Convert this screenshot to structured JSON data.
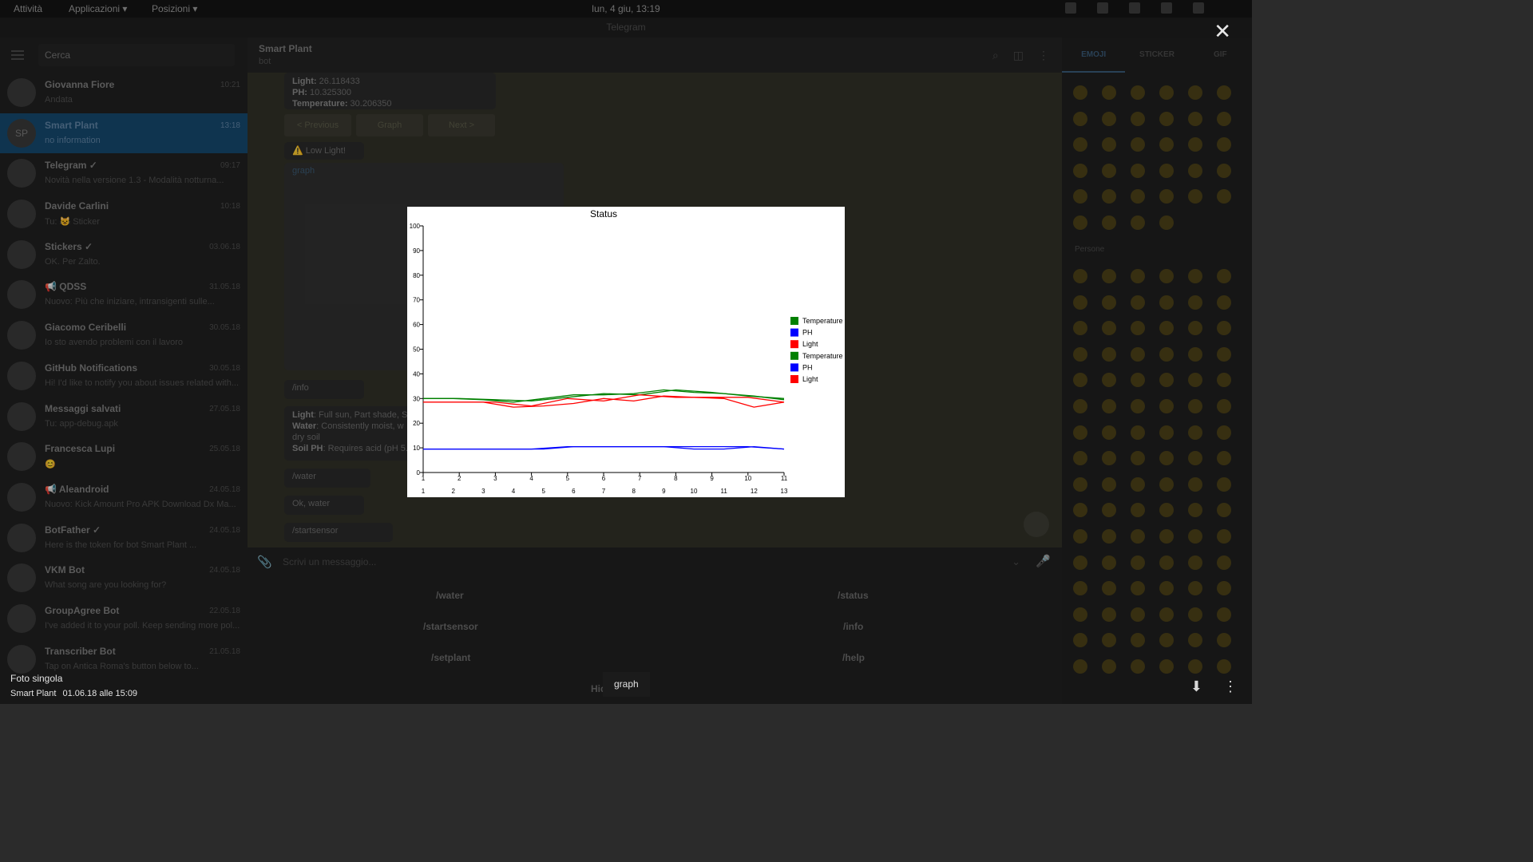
{
  "topbar": {
    "activities": "Attività",
    "applications": "Applicazioni ▾",
    "places": "Posizioni ▾",
    "clock": "lun, 4 giu, 13:19"
  },
  "window": {
    "title": "Telegram"
  },
  "sidebar": {
    "search_placeholder": "Cerca",
    "chats": [
      {
        "name": "Giovanna Fiore",
        "time": "10:21",
        "preview": "Andata",
        "initials": ""
      },
      {
        "name": "Smart Plant",
        "time": "13:18",
        "preview": "no information",
        "initials": "SP"
      },
      {
        "name": "Telegram ✓",
        "time": "09:17",
        "preview": "Novità nella versione 1.3 - Modalità notturna...",
        "initials": ""
      },
      {
        "name": "Davide Carlini",
        "time": "10:18",
        "preview": "Tu: 😺 Sticker",
        "initials": ""
      },
      {
        "name": "Stickers ✓",
        "time": "03.06.18",
        "preview": "OK. Per Zalto.",
        "initials": ""
      },
      {
        "name": "📢 QDSS",
        "time": "31.05.18",
        "preview": "Nuovo: Più che iniziare, intransigenti sulle...",
        "initials": ""
      },
      {
        "name": "Giacomo Ceribelli",
        "time": "30.05.18",
        "preview": "Io sto avendo problemi con il lavoro",
        "initials": ""
      },
      {
        "name": "GitHub Notifications",
        "time": "30.05.18",
        "preview": "Hi! I'd like to notify you about issues related with...",
        "initials": ""
      },
      {
        "name": "Messaggi salvati",
        "time": "27.05.18",
        "preview": "Tu: app-debug.apk",
        "initials": ""
      },
      {
        "name": "Francesca Lupi",
        "time": "25.05.18",
        "preview": "😊",
        "initials": ""
      },
      {
        "name": "📢 Aleandroid",
        "time": "24.05.18",
        "preview": "Nuovo: Kick Amount Pro APK Download Dx Ma...",
        "initials": ""
      },
      {
        "name": "BotFather ✓",
        "time": "24.05.18",
        "preview": "Here is the token for bot Smart Plant ...",
        "initials": ""
      },
      {
        "name": "VKM Bot",
        "time": "24.05.18",
        "preview": "What song are you looking for?",
        "initials": ""
      },
      {
        "name": "GroupAgree Bot",
        "time": "22.05.18",
        "preview": "I've added it to your poll. Keep sending more pol...",
        "initials": ""
      },
      {
        "name": "Transcriber Bot",
        "time": "21.05.18",
        "preview": "Tap on Antica Roma's button below to...",
        "initials": ""
      }
    ]
  },
  "chat": {
    "title": "Smart Plant",
    "subtitle": "bot",
    "status_lines": [
      {
        "label": "Light:",
        "value": " 26.118433"
      },
      {
        "label": "PH:",
        "value": " 10.325300"
      },
      {
        "label": "Temperature:",
        "value": " 30.206350"
      }
    ],
    "inline_buttons": [
      "< Previous",
      "Graph",
      "Next >"
    ],
    "low_light": "⚠️ Low Light!",
    "graph_label": "graph",
    "info_cmd": "/info",
    "info_lines": [
      {
        "label": "Light",
        "value": ": Full sun, Part shade, Sh"
      },
      {
        "label": "Water",
        "value": ": Consistently moist, w"
      },
      {
        "label": "",
        "value": "dry soil"
      },
      {
        "label": "Soil PH",
        "value": ": Requires acid (pH 5.5"
      }
    ],
    "water_cmd": "/water",
    "ok_water": "Ok, water",
    "startsensor_cmd": "/startsensor",
    "input_placeholder": "Scrivi un messaggio...",
    "commands": [
      "/water",
      "/status",
      "/startsensor",
      "/info",
      "/setplant",
      "/help"
    ],
    "hide_buttons": "Hide buttons"
  },
  "emoji_panel": {
    "tabs": [
      "EMOJI",
      "STICKER",
      "GIF"
    ],
    "section": "Persone"
  },
  "viewer": {
    "close": "✕",
    "caption": "graph",
    "footer_title": "Foto singola",
    "footer_sender": "Smart Plant",
    "footer_date": "01.06.18 alle 15:09",
    "tools": [
      "⬇",
      "⋮"
    ]
  },
  "chart_data": {
    "type": "line",
    "title": "Status",
    "ylim": [
      0,
      100
    ],
    "yticks": [
      0,
      10,
      20,
      30,
      40,
      50,
      60,
      70,
      80,
      90,
      100
    ],
    "x_axis_1": [
      1,
      2,
      3,
      4,
      5,
      6,
      7,
      8,
      9,
      10,
      11
    ],
    "x_axis_2": [
      1,
      2,
      3,
      4,
      5,
      6,
      7,
      8,
      9,
      10,
      11,
      12,
      13
    ],
    "legend": [
      "Temperature",
      "PH",
      "Light",
      "Temperature",
      "PH",
      "Light"
    ],
    "legend_placement": "right",
    "colors": {
      "Temperature": "#008000",
      "PH": "#0000ff",
      "Light": "#ff0000"
    },
    "series": [
      {
        "name": "Temperature",
        "axis": 1,
        "color": "#008000",
        "values": [
          30,
          30,
          29.5,
          29,
          30.5,
          32,
          31.5,
          33.5,
          32.5,
          31,
          30
        ]
      },
      {
        "name": "PH",
        "axis": 1,
        "color": "#0000ff",
        "values": [
          9.5,
          9.5,
          9.5,
          9.5,
          10.5,
          10.5,
          10.5,
          10.5,
          10.5,
          10.5,
          9.5
        ]
      },
      {
        "name": "Light",
        "axis": 1,
        "color": "#ff0000",
        "values": [
          28.5,
          28.5,
          28.5,
          27,
          30,
          29,
          31.5,
          30.5,
          30.5,
          30.5,
          28.5
        ]
      },
      {
        "name": "Temperature",
        "axis": 2,
        "color": "#008000",
        "values": [
          30,
          30,
          29.5,
          28.5,
          30,
          31.5,
          31.5,
          32,
          33.5,
          32.5,
          32,
          31,
          29.5
        ]
      },
      {
        "name": "PH",
        "axis": 2,
        "color": "#0000ff",
        "values": [
          9.5,
          9.5,
          9.5,
          9.5,
          9.5,
          10.5,
          10.5,
          10.5,
          10.5,
          9.5,
          9.5,
          10.5,
          9.5
        ]
      },
      {
        "name": "Light",
        "axis": 2,
        "color": "#ff0000",
        "values": [
          28.5,
          28.5,
          28.5,
          26.5,
          27,
          28,
          30,
          29,
          31,
          30.5,
          30,
          26.5,
          28.5
        ]
      }
    ]
  }
}
